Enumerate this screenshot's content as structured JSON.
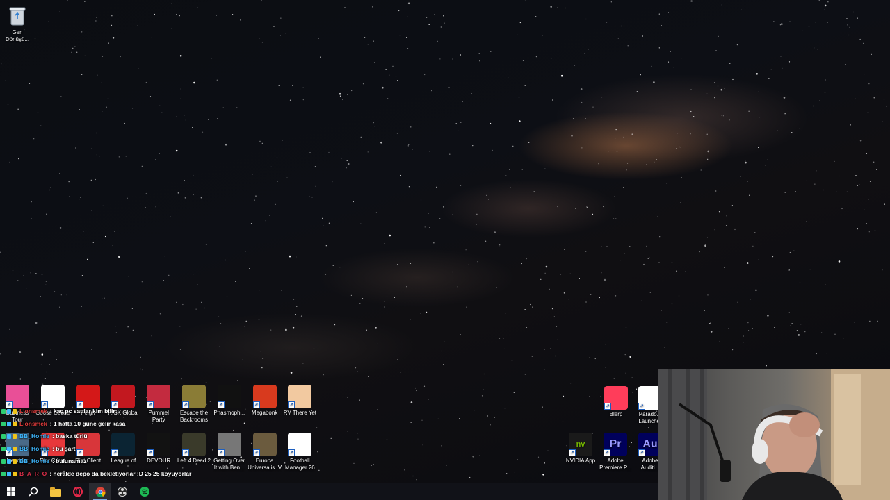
{
  "desktop": {
    "recycle_bin": {
      "label_1": "Geri",
      "label_2": "Dönüşü..."
    },
    "icons_top_row": [
      {
        "label": "Business Tour",
        "color": "#e94f97"
      },
      {
        "label": "Goose Goose",
        "color": "#ffffff"
      },
      {
        "label": "Feign",
        "color": "#d41818"
      },
      {
        "label": "RISK Global",
        "color": "#c2181f"
      },
      {
        "label": "Pummel Party",
        "color": "#c32b3f"
      },
      {
        "label": "Escape the Backrooms",
        "color": "#8a7c36"
      },
      {
        "label": "Phasmoph...",
        "color": "#111111"
      },
      {
        "label": "Megabonk",
        "color": "#d83a1e"
      },
      {
        "label": "RV There Yet",
        "color": "#f2c9a0"
      }
    ],
    "icons_bottom_row": [
      {
        "label": "Need for",
        "color": "#4a6a88"
      },
      {
        "label": "Riot Client",
        "color": "#e8383b"
      },
      {
        "label": "Riot Client",
        "color": "#d8363a"
      },
      {
        "label": "League of",
        "color": "#0b2433"
      },
      {
        "label": "DEVOUR",
        "color": "#121212"
      },
      {
        "label": "Left 4 Dead 2",
        "color": "#3a3a2a"
      },
      {
        "label": "Getting Over It with Ben...",
        "color": "#777777"
      },
      {
        "label": "Europa Universalis IV",
        "color": "#6b5b3e"
      },
      {
        "label": "Football Manager 26",
        "color": "#ffffff"
      }
    ],
    "icons_right_top": [
      {
        "label": "Blerp",
        "color": "#ff3d5a"
      },
      {
        "label": "Parado... Launcher",
        "color": "#ffffff"
      }
    ],
    "icons_right_bottom": [
      {
        "label": "NVIDIA App",
        "color": "#1a1a1a",
        "glyph": "nv"
      },
      {
        "label": "Adobe Premiere P...",
        "color": "#00005b",
        "glyph": "Pr"
      },
      {
        "label": "Adobe Auditi...",
        "color": "#00005b",
        "glyph": "Au"
      }
    ]
  },
  "chat": [
    {
      "user": "Lionsmek",
      "user_color": "#e23c3c",
      "message": ": kaç pc satılar kim bilir"
    },
    {
      "user": "Lionsmek",
      "user_color": "#e23c3c",
      "message": ": 1 hafta 10 güne gelir kasa"
    },
    {
      "user": "BB_Homie",
      "user_color": "#3fb8ff",
      "message": ": baska türlü"
    },
    {
      "user": "BB_Homie",
      "user_color": "#3fb8ff",
      "message": ": bu şart"
    },
    {
      "user": "BB_Homie",
      "user_color": "#3fb8ff",
      "message": ": bulunamaz"
    },
    {
      "user": "B_A_R_O",
      "user_color": "#e0304b",
      "message": ": heralde depo da bekletiyorlar :D 25 25 koyuyorlar"
    }
  ],
  "taskbar": {
    "items": [
      {
        "name": "start-icon"
      },
      {
        "name": "search-icon"
      },
      {
        "name": "file-explorer-icon"
      },
      {
        "name": "opera-gx-icon"
      },
      {
        "name": "chrome-icon"
      },
      {
        "name": "obs-icon"
      },
      {
        "name": "spotify-icon"
      }
    ]
  },
  "colors": {
    "accent": "#7aa6e0",
    "taskbar": "#111218"
  }
}
